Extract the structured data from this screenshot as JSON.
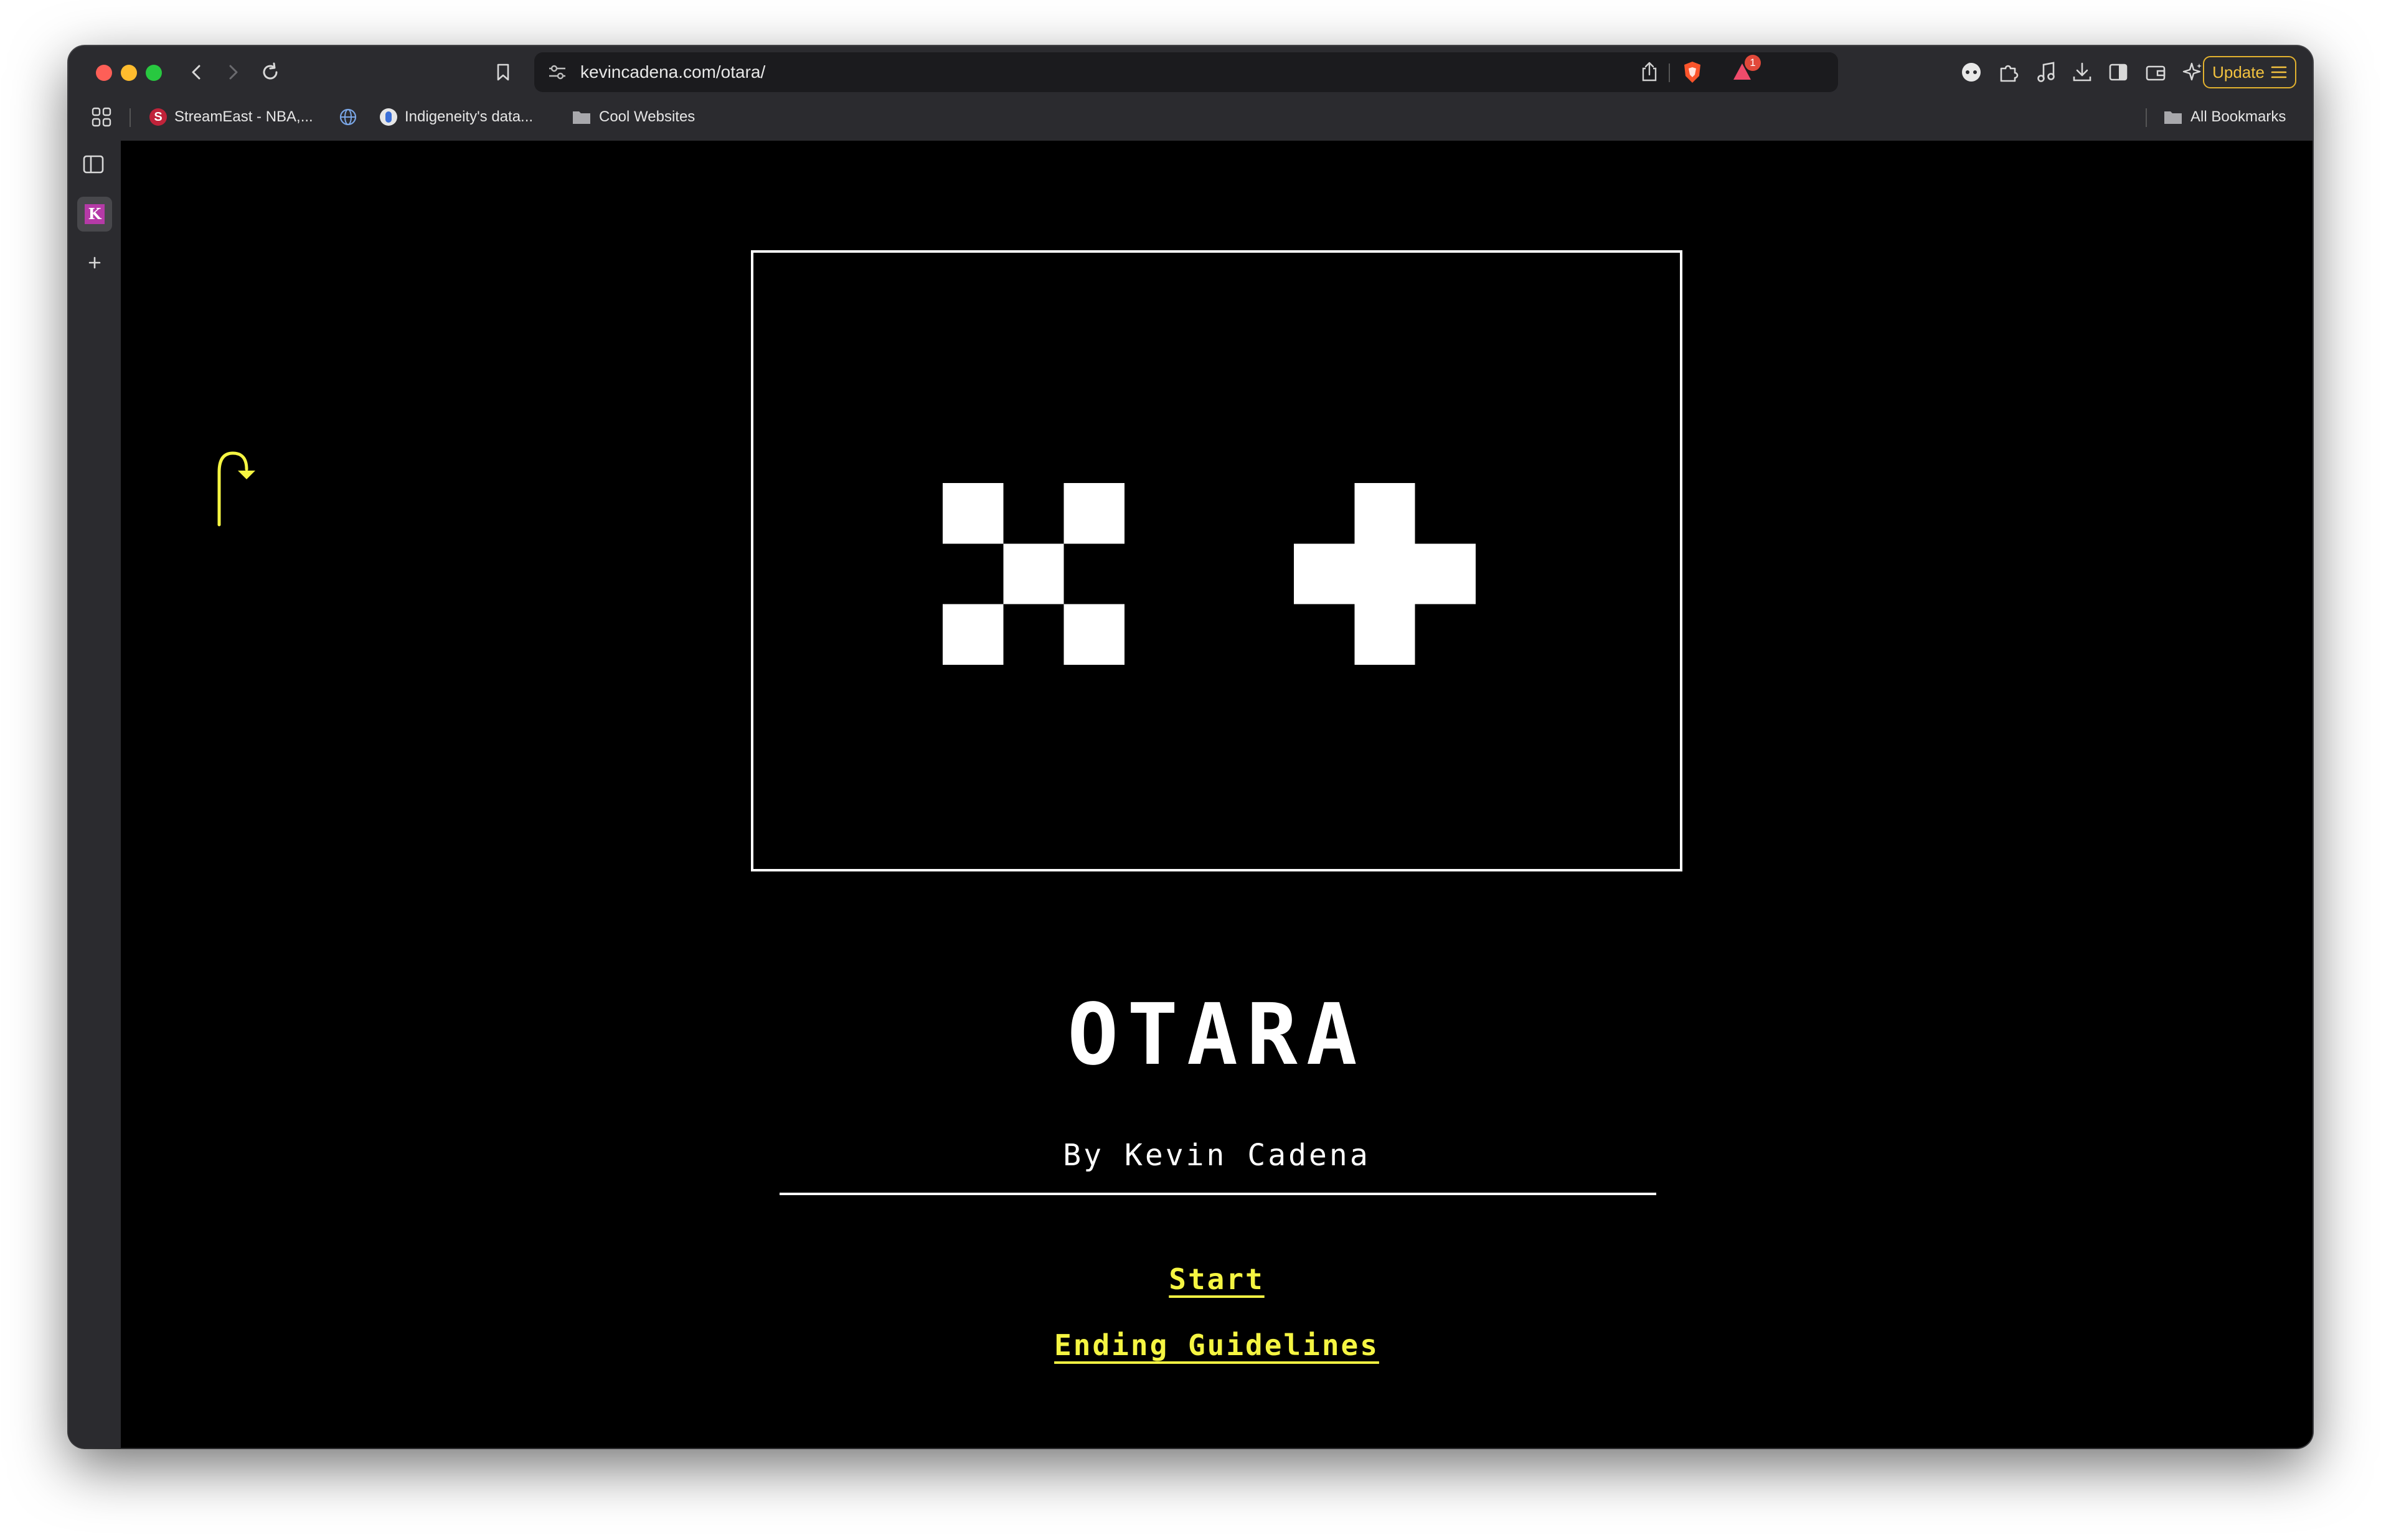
{
  "browser": {
    "url": "kevincadena.com/otara/",
    "notification_count": "1",
    "update_label": "Update",
    "bookmarks": [
      {
        "label": "StreamEast - NBA,..."
      },
      {
        "label": "Indigeneity's data..."
      },
      {
        "label": "Cool Websites"
      }
    ],
    "all_bookmarks_label": "All Bookmarks",
    "accent_color": "#f5f542"
  },
  "page": {
    "title": "OTARA",
    "byline": "By Kevin Cadena",
    "links": {
      "start": "Start",
      "ending_guidelines": "Ending Guidelines"
    },
    "colors": {
      "background": "#000000",
      "foreground": "#ffffff",
      "link": "#f5f542"
    },
    "icons": {
      "left_glyph": "pixel-x-icon",
      "right_glyph": "pixel-plus-icon",
      "side_arrow": "curved-arrow-icon"
    }
  }
}
